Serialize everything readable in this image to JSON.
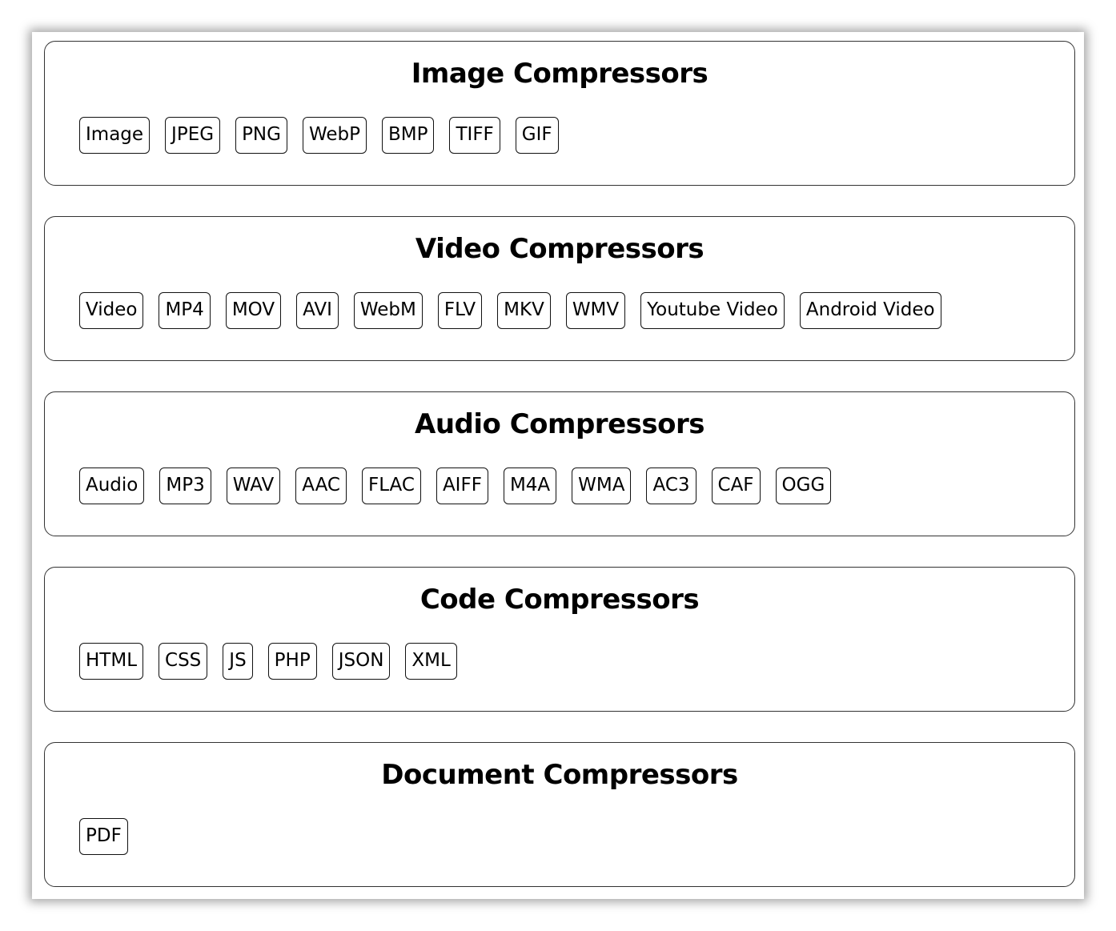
{
  "sections": [
    {
      "title": "Image Compressors",
      "items": [
        "Image",
        "JPEG",
        "PNG",
        "WebP",
        "BMP",
        "TIFF",
        "GIF"
      ]
    },
    {
      "title": "Video Compressors",
      "items": [
        "Video",
        "MP4",
        "MOV",
        "AVI",
        "WebM",
        "FLV",
        "MKV",
        "WMV",
        "Youtube Video",
        "Android Video"
      ]
    },
    {
      "title": "Audio Compressors",
      "items": [
        "Audio",
        "MP3",
        "WAV",
        "AAC",
        "FLAC",
        "AIFF",
        "M4A",
        "WMA",
        "AC3",
        "CAF",
        "OGG"
      ]
    },
    {
      "title": "Code Compressors",
      "items": [
        "HTML",
        "CSS",
        "JS",
        "PHP",
        "JSON",
        "XML"
      ]
    },
    {
      "title": "Document Compressors",
      "items": [
        "PDF"
      ]
    }
  ]
}
